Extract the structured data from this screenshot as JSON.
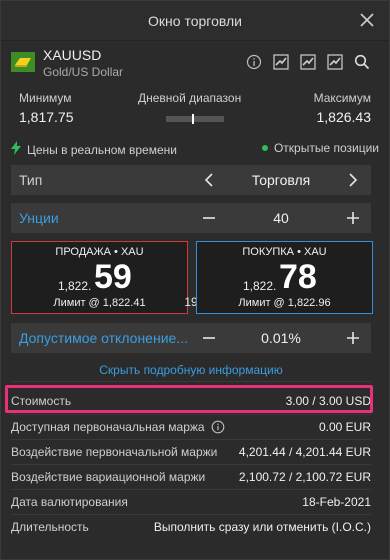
{
  "window": {
    "title": "Окно торговли"
  },
  "instrument": {
    "symbol": "XAUUSD",
    "name": "Gold/US Dollar"
  },
  "range": {
    "min_label": "Минимум",
    "min_value": "1,817.75",
    "day_label": "Дневной диапазон",
    "max_label": "Максимум",
    "max_value": "1,826.43"
  },
  "status": {
    "realtime": "Цены в реальном времени",
    "positions": "Открытые позиции"
  },
  "type_row": {
    "label": "Тип",
    "value": "Торговля"
  },
  "units_row": {
    "label": "Унции",
    "value": "40"
  },
  "sell": {
    "title": "ПРОДАЖА • XAU",
    "prefix": "1,822.",
    "big": "59",
    "limit": "Лимит @ 1,822.41"
  },
  "buy": {
    "title": "ПОКУПКА • XAU",
    "prefix": "1,822.",
    "big": "78",
    "limit": "Лимит @ 1,822.96"
  },
  "spread": "19",
  "slippage_row": {
    "label": "Допустимое отклонение...",
    "value": "0.01%"
  },
  "details_link": "Скрыть подробную информацию",
  "details": [
    {
      "key": "Стоимость",
      "value": "3.00 / 3.00 USD"
    },
    {
      "key": "Доступная первоначальная маржа",
      "value": "0.00 EUR"
    },
    {
      "key": "Воздействие первоначальной маржи",
      "value": "4,201.44 / 4,201.44 EUR"
    },
    {
      "key": "Воздействие вариационной маржи",
      "value": "2,100.72 / 2,100.72 EUR"
    },
    {
      "key": "Дата валютирования",
      "value": "18-Feb-2021"
    },
    {
      "key": "Длительность",
      "value": "Выполнить сразу или отменить (I.O.C.)"
    }
  ],
  "colors": {
    "sell": "#d23a3a",
    "buy": "#3a8ed6",
    "link": "#3a9ee0",
    "highlight": "#e8317a",
    "live": "#2ebd59"
  }
}
